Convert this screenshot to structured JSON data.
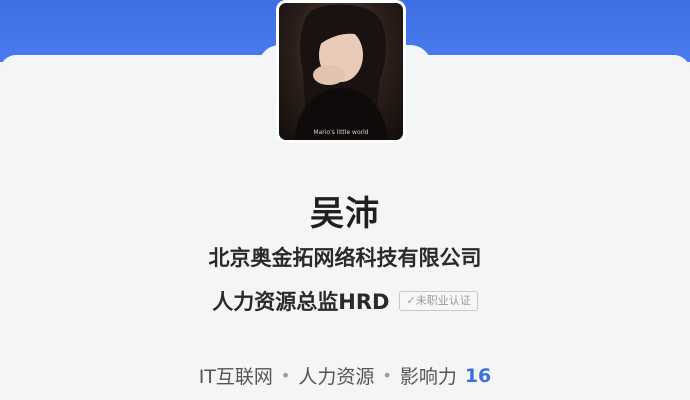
{
  "profile": {
    "name": "吴沛",
    "company": "北京奥金拓网络科技有限公司",
    "job_title": "人力资源总监HRD",
    "badge": "未职业认证",
    "tags": [
      "IT互联网",
      "人力资源"
    ],
    "separator": "•",
    "influence_label": "影响力",
    "influence_value": "16",
    "avatar_caption": "Mario's little world"
  },
  "colors": {
    "banner_blue": "#3d6ee2",
    "background": "#f4f5f7",
    "text": "#2a2a2a"
  }
}
